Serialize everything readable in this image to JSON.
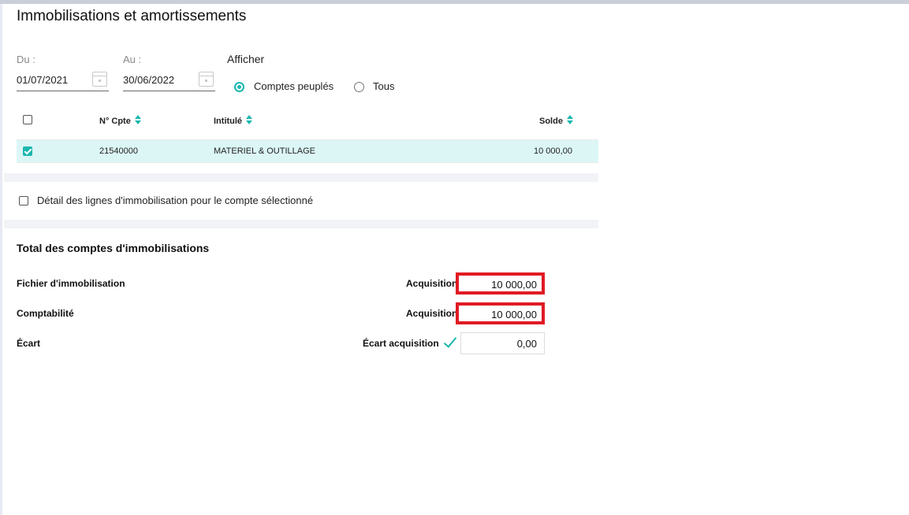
{
  "page": {
    "title": "Immobilisations et amortissements"
  },
  "filters": {
    "from_label": "Du :",
    "from_value": "01/07/2021",
    "to_label": "Au :",
    "to_value": "30/06/2022",
    "show_label": "Afficher",
    "options": [
      {
        "label": "Comptes peuplés",
        "selected": true
      },
      {
        "label": "Tous",
        "selected": false
      }
    ]
  },
  "table": {
    "headers": {
      "account": "N° Cpte",
      "label": "Intitulé",
      "balance": "Solde"
    },
    "rows": [
      {
        "checked": true,
        "account": "21540000",
        "label": "MATERIEL & OUTILLAGE",
        "balance": "10 000,00"
      }
    ]
  },
  "detail_checkbox": {
    "label": "Détail des lignes d'immobilisation pour le compte sélectionné",
    "checked": false
  },
  "totals": {
    "title": "Total des comptes d'immobilisations",
    "rows": [
      {
        "label": "Fichier d'immobilisation",
        "field_label": "Acquisition",
        "value": "10 000,00"
      },
      {
        "label": "Comptabilité",
        "field_label": "Acquisition",
        "value": "10 000,00"
      },
      {
        "label": "Écart",
        "field_label": "Écart acquisition",
        "value": "0,00"
      }
    ]
  },
  "colors": {
    "accent": "#1bb7b0",
    "highlight_row": "#dcf6f6",
    "annotation": "#e01b24"
  }
}
